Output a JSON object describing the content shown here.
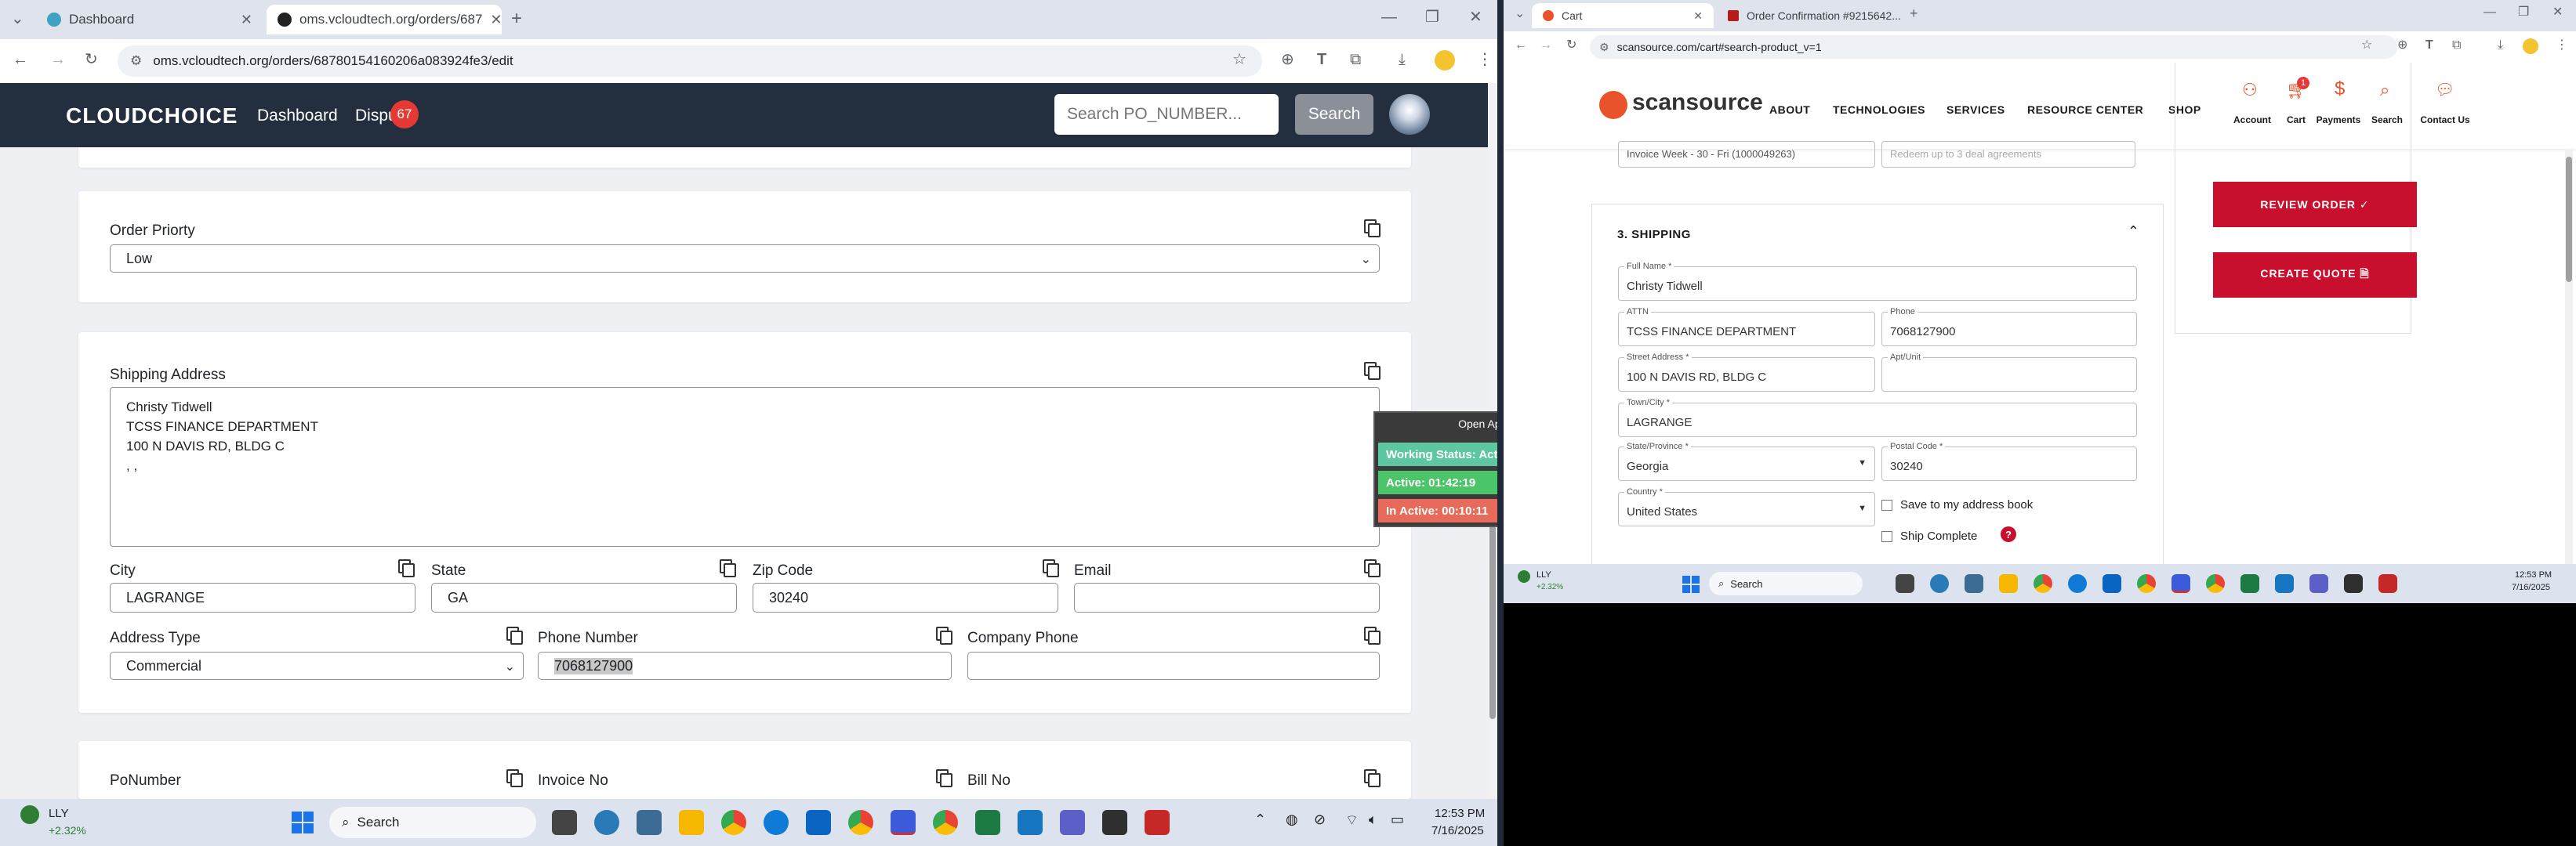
{
  "left_window": {
    "tabs": [
      {
        "label": "Dashboard",
        "active": false
      },
      {
        "label": "oms.vcloudtech.org/orders/687",
        "active": true
      }
    ],
    "url": "oms.vcloudtech.org/orders/68780154160206a083924fe3/edit",
    "navbar": {
      "logo": "CLOUDCHOICE",
      "links": [
        "Dashboard",
        "Dispu"
      ],
      "dispute_badge": "67",
      "search_placeholder": "Search PO_NUMBER...",
      "search_button": "Search"
    },
    "order_priority": {
      "label": "Order Priorty",
      "value": "Low"
    },
    "shipping_address": {
      "label": "Shipping Address",
      "lines": [
        "Christy Tidwell",
        "TCSS FINANCE DEPARTMENT",
        "100 N DAVIS RD, BLDG C",
        ", ,"
      ]
    },
    "city": {
      "label": "City",
      "value": "LAGRANGE"
    },
    "state": {
      "label": "State",
      "value": "GA"
    },
    "zip": {
      "label": "Zip Code",
      "value": "30240"
    },
    "email": {
      "label": "Email",
      "value": ""
    },
    "address_type": {
      "label": "Address Type",
      "value": "Commercial"
    },
    "phone": {
      "label": "Phone Number",
      "value": "7068127900"
    },
    "company_phone": {
      "label": "Company Phone",
      "value": ""
    },
    "bottom_labels": [
      "PoNumber",
      "Invoice No",
      "Bill No"
    ],
    "widget": {
      "open_app": "Open App ↗",
      "working_status": "Working Status: Active",
      "active": "Active: 01:42:19",
      "inactive": "In Active: 00:10:11"
    },
    "taskbar": {
      "stock": "LLY",
      "stock_change": "+2.32%",
      "search": "Search",
      "time": "12:53 PM",
      "date": "7/16/2025"
    }
  },
  "right_window": {
    "tabs": [
      {
        "label": "Cart",
        "active": true
      },
      {
        "label": "Order Confirmation #9215642...",
        "active": false
      }
    ],
    "url": "scansource.com/cart#search-product_v=1",
    "logo": "scansource",
    "nav": [
      "ABOUT",
      "TECHNOLOGIES",
      "SERVICES",
      "RESOURCE CENTER",
      "SHOP"
    ],
    "icons": [
      "Account",
      "Cart",
      "Payments",
      "Search",
      "Contact Us"
    ],
    "cart_badge": "1",
    "top_fields": [
      "Invoice Week - 30 - Fri (1000049263)",
      "Redeem up to 3 deal agreements"
    ],
    "section_title": "3. SHIPPING",
    "fields": {
      "full_name": {
        "label": "Full Name *",
        "value": "Christy Tidwell"
      },
      "attn": {
        "label": "ATTN",
        "value": "TCSS FINANCE DEPARTMENT"
      },
      "phone": {
        "label": "Phone",
        "value": "7068127900"
      },
      "street": {
        "label": "Street Address *",
        "value": "100 N DAVIS RD, BLDG C"
      },
      "apt": {
        "label": "Apt/Unit",
        "value": ""
      },
      "town": {
        "label": "Town/City *",
        "value": "LAGRANGE"
      },
      "state": {
        "label": "State/Province *",
        "value": "Georgia"
      },
      "postal": {
        "label": "Postal Code *",
        "value": "30240"
      },
      "country": {
        "label": "Country *",
        "value": "United States"
      }
    },
    "save_address": "Save to my address book",
    "ship_complete": "Ship Complete",
    "review_order": "REVIEW ORDER ✓",
    "create_quote": "CREATE QUOTE 🗎",
    "taskbar": {
      "stock": "LLY",
      "stock_change": "+2.32%",
      "search": "Search",
      "time": "12:53 PM",
      "date": "7/16/2025"
    }
  }
}
